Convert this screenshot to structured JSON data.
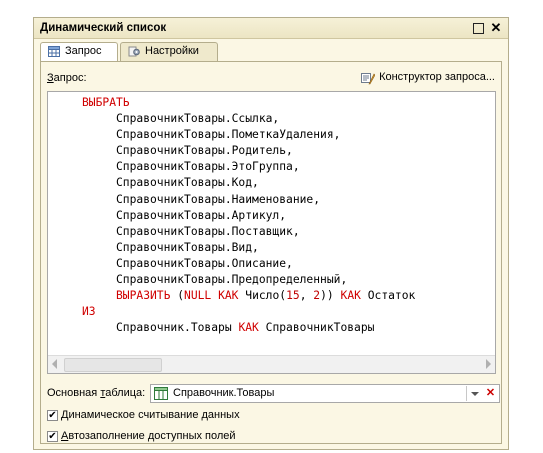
{
  "window": {
    "title": "Динамический список"
  },
  "tabs": [
    {
      "label": "Запрос",
      "icon": "table-icon"
    },
    {
      "label": "Настройки",
      "icon": "settings-icon"
    }
  ],
  "query": {
    "label_underlined": "З",
    "label_rest": "апрос:",
    "constructor_label": "Конструктор запроса...",
    "code": {
      "select_kw": "ВЫБРАТЬ",
      "fields": [
        "СправочникТовары.Ссылка,",
        "СправочникТовары.ПометкаУдаления,",
        "СправочникТовары.Родитель,",
        "СправочникТовары.ЭтоГруппа,",
        "СправочникТовары.Код,",
        "СправочникТовары.Наименование,",
        "СправочникТовары.Артикул,",
        "СправочникТовары.Поставщик,",
        "СправочникТовары.Вид,",
        "СправочникТовары.Описание,",
        "СправочникТовары.Предопределенный,"
      ],
      "expr_func": "ВЫРАЗИТЬ",
      "expr_open": " (",
      "expr_null": "NULL",
      "expr_sp1": " ",
      "expr_as1": "КАК",
      "expr_type": " Число(",
      "expr_n1": "15",
      "expr_comma": ", ",
      "expr_n2": "2",
      "expr_close": ")) ",
      "expr_as2": "КАК",
      "expr_alias": " Остаток",
      "from_kw": "ИЗ",
      "source_name": "Справочник.Товары ",
      "source_as": "КАК",
      "source_alias": " СправочникТовары"
    }
  },
  "main_table": {
    "label_pre": "Основная ",
    "label_underlined": "т",
    "label_post": "аблица:",
    "value": "Справочник.Товары"
  },
  "options": [
    {
      "pre": "",
      "underlined": "Д",
      "post": "инамическое считывание данных",
      "checked": true
    },
    {
      "pre": "",
      "underlined": "А",
      "post": "втозаполнение доступных полей",
      "checked": true
    }
  ]
}
